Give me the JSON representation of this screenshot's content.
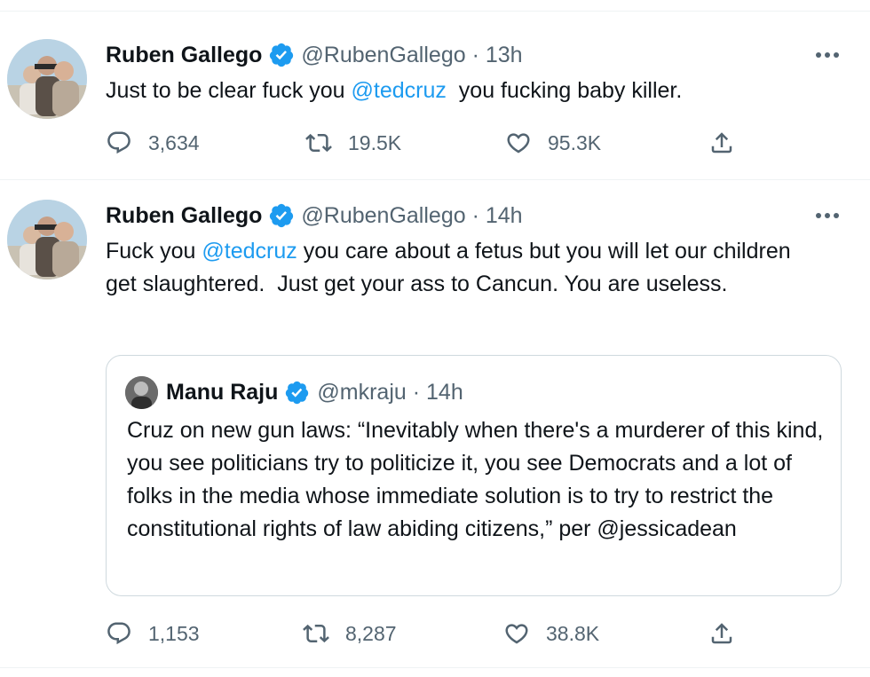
{
  "colors": {
    "link": "#1d9bf0",
    "verified": "#1d9bf0",
    "secondary_text": "#536471"
  },
  "tweets": [
    {
      "author_name": "Ruben Gallego",
      "handle_time": "@RubenGallego · 13h",
      "text_parts": [
        "Just to be clear fuck you ",
        "@tedcruz",
        "  you fucking baby killer."
      ],
      "replies": "3,634",
      "retweets": "19.5K",
      "likes": "95.3K",
      "more_icon": "more-icon"
    },
    {
      "author_name": "Ruben Gallego",
      "handle_time": "@RubenGallego · 14h",
      "text_parts": [
        "Fuck you ",
        "@tedcruz",
        " you care about a fetus but you will let our children get slaughtered.  Just get your ass to Cancun. You are useless."
      ],
      "quoted": {
        "author_name": "Manu Raju",
        "handle_time": "@mkraju · 14h",
        "text": "Cruz on new gun laws: “Inevitably when there's a murderer of this kind, you see politicians try to politicize it, you see Democrats and a lot of folks in the media whose immediate solution is to try to restrict the constitutional rights of law abiding citizens,” per @jessicadean"
      },
      "replies": "1,153",
      "retweets": "8,287",
      "likes": "38.8K",
      "more_icon": "more-icon"
    }
  ]
}
